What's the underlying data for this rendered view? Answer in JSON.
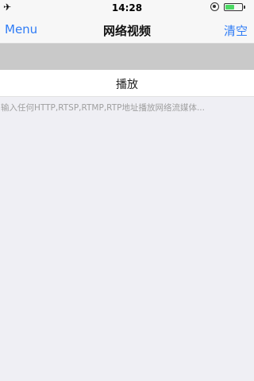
{
  "status_bar": {
    "time": "14:28",
    "battery_level": 0.55,
    "battery_color": "#4cd964"
  },
  "nav": {
    "left_label": "Menu",
    "title": "网络视频",
    "right_label": "清空",
    "accent_color": "#2f7cf6"
  },
  "main": {
    "play_label": "播放",
    "url_placeholder": "输入任何HTTP,RTSP,RTMP,RTP地址播放网络流媒体..."
  }
}
